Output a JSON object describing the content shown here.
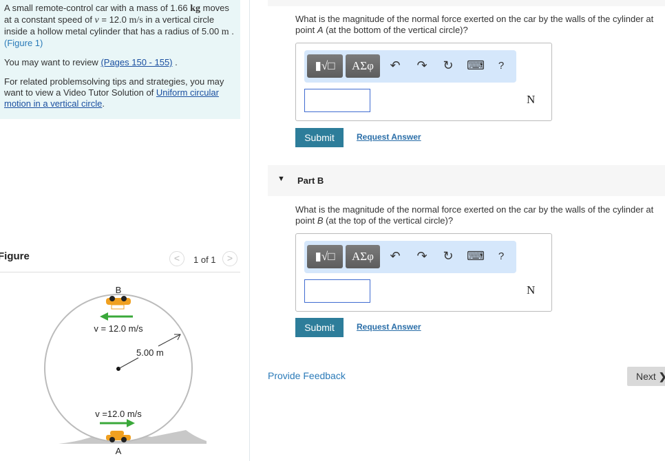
{
  "intro": {
    "line1_a": "A small remote-control car with a mass of 1.66 ",
    "unit_kg": "kg",
    "line1_b": " moves at a constant speed of ",
    "v": "v",
    "eq": " = 12.0 ",
    "unit_ms": "m/s",
    "line1_c": " in a vertical circle inside a hollow metal cylinder that has a radius of 5.00 ",
    "unit_m": "m",
    "line1_d": " . ",
    "figure_link": "(Figure 1)",
    "review_pre": "You may want to review ",
    "review_link": "(Pages 150 - 155)",
    "review_post": " .",
    "tips_pre": "For related problemsolving tips and strategies, you may want to view a Video Tutor Solution of ",
    "tips_link": "Uniform circular motion in a vertical circle",
    "tips_post": "."
  },
  "figure": {
    "title": "Figure",
    "pager": "1 of 1",
    "prev": "<",
    "next": ">",
    "label_b": "B",
    "label_a": "A",
    "v_top": "v = 12.0 m/s",
    "v_bottom": "v =12.0 m/s",
    "radius": "5.00 m",
    "arrow_color": "#3aa83a",
    "car_color": "#f0a020"
  },
  "toolbar": {
    "templates": "▮√□",
    "greek": "ΑΣφ",
    "undo": "↶",
    "redo": "↷",
    "reset": "↻",
    "keyboard": "⌨",
    "help": "?"
  },
  "part_a": {
    "question_pre": "What is the magnitude of the normal force exerted on the car by the walls of the cylinder at point ",
    "point": "A",
    "question_post": " (at the bottom of the vertical circle)?",
    "answer": "",
    "unit": "N",
    "submit": "Submit",
    "request": "Request Answer"
  },
  "part_b": {
    "header": "Part B",
    "question_pre": "What is the magnitude of the normal force exerted on the car by the walls of the cylinder at point ",
    "point": "B",
    "question_post": " (at the top of the vertical circle)?",
    "answer": "",
    "unit": "N",
    "submit": "Submit",
    "request": "Request Answer"
  },
  "footer": {
    "feedback": "Provide Feedback",
    "next": "Next",
    "next_icon": "❯"
  },
  "colors": {
    "intro_bg": "#e9f6f7",
    "submit": "#2d7d9a",
    "toolbar_bg": "#d5e7fb"
  }
}
